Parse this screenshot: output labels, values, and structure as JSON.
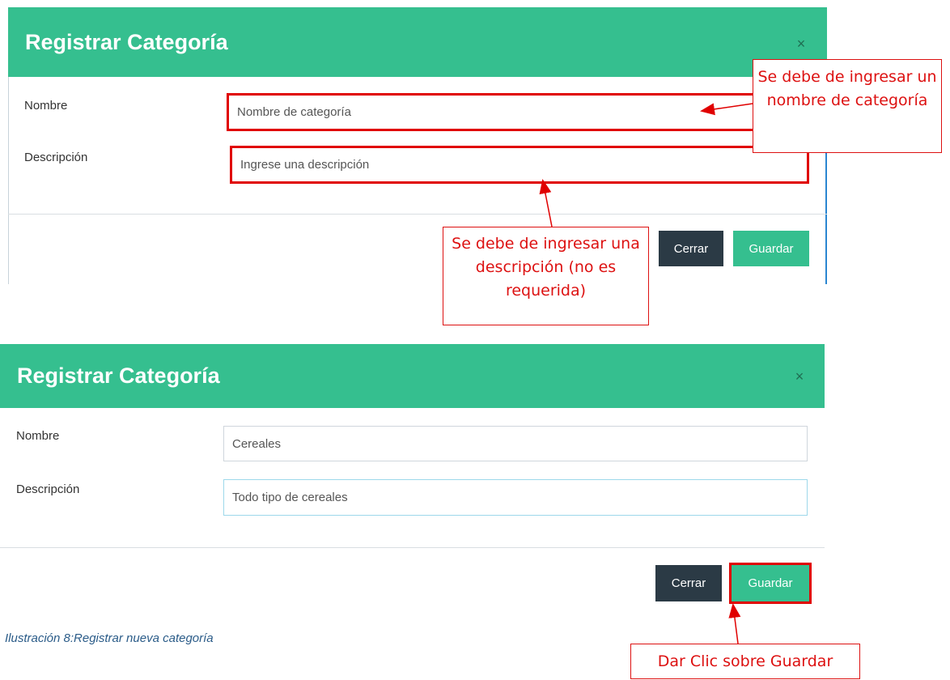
{
  "modal_top": {
    "title": "Registrar Categoría",
    "close_symbol": "×",
    "nombre_label": "Nombre",
    "nombre_placeholder": "Nombre de categoría",
    "descripcion_label": "Descripción",
    "descripcion_placeholder": "Ingrese una descripción",
    "cerrar_label": "Cerrar",
    "guardar_label": "Guardar"
  },
  "modal_bottom": {
    "title": "Registrar Categoría",
    "close_symbol": "×",
    "nombre_label": "Nombre",
    "nombre_value": "Cereales",
    "descripcion_label": "Descripción",
    "descripcion_value": "Todo tipo de cereales",
    "cerrar_label": "Cerrar",
    "guardar_label": "Guardar"
  },
  "callouts": {
    "nombre_note": "Se debe de ingresar un nombre de categoría",
    "descripcion_note": "Se debe de ingresar una descripción (no es requerida)",
    "guardar_note": "Dar Clic sobre Guardar"
  },
  "caption": "Ilustración 8:Registrar nueva categoría",
  "colors": {
    "header_green": "#35bf8f",
    "button_dark": "#2b3a45",
    "annotation_red": "#e00000"
  }
}
